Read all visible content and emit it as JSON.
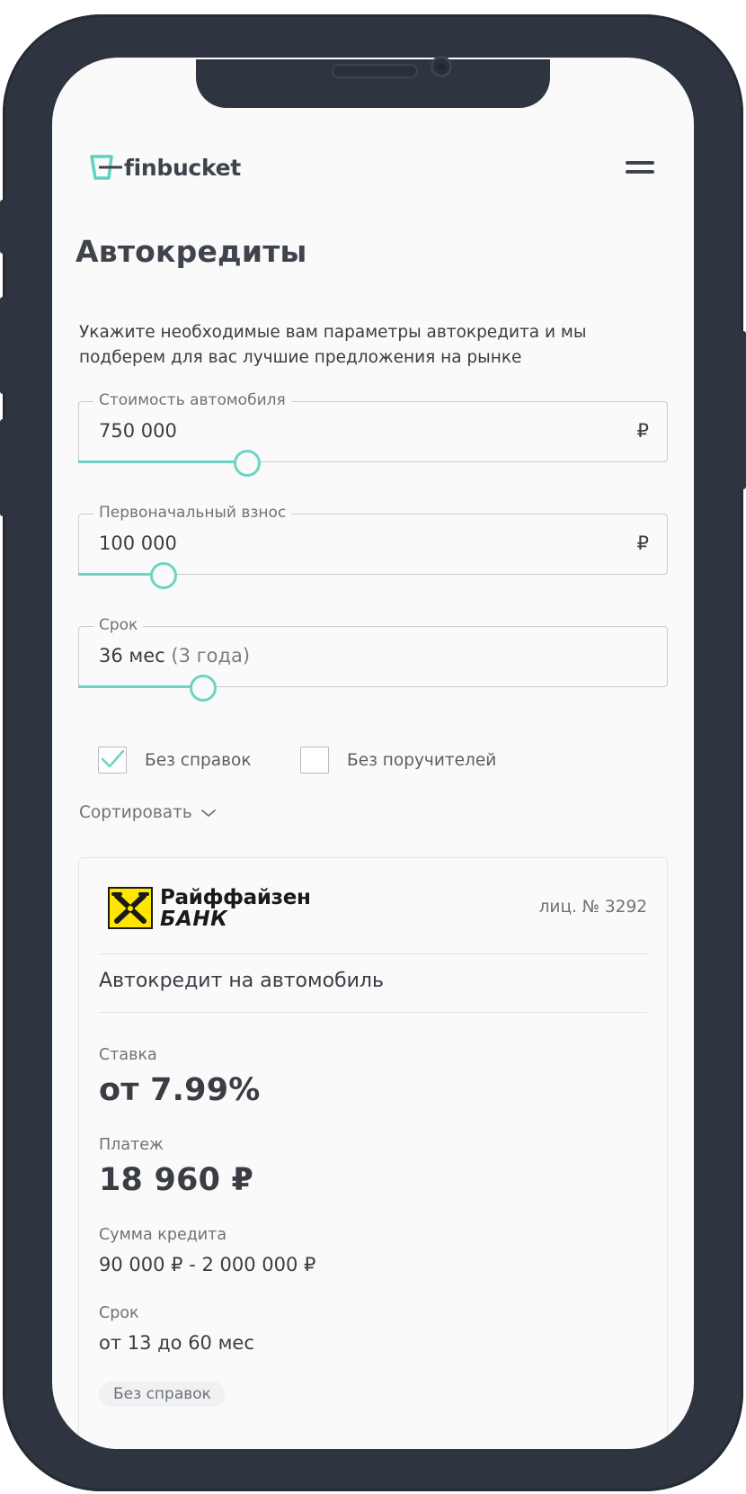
{
  "header": {
    "logo_text": "finbucket",
    "menu_icon": "hamburger-menu-icon"
  },
  "page": {
    "title": "Автокредиты",
    "intro_line1": "Укажите необходимые вам параметры автокредита и мы",
    "intro_line2": "подберем для вас лучшие предложения на рынке"
  },
  "form": {
    "price": {
      "label": "Стоимость автомобиля",
      "value": "750 000",
      "currency": "₽",
      "slider_fraction": 0.285
    },
    "down_payment": {
      "label": "Первоначальный взнос",
      "value": "100 000",
      "currency": "₽",
      "slider_fraction": 0.143
    },
    "term": {
      "label": "Срок",
      "value": "36 мес",
      "hint": "(3 года)",
      "slider_fraction": 0.21
    },
    "no_certificates": {
      "label": "Без справок",
      "checked": true
    },
    "no_guarantors": {
      "label": "Без поручителей",
      "checked": false
    },
    "sort_label": "Сортировать"
  },
  "offer": {
    "bank_name_line1": "Райффайзен",
    "bank_name_line2": "БАНК",
    "license": "лиц. № 3292",
    "product": "Автокредит на автомобиль",
    "rate_label": "Ставка",
    "rate_value": "от 7.99%",
    "payment_label": "Платеж",
    "payment_value": "18 960 ₽",
    "amount_label": "Сумма кредита",
    "amount_value": "90 000 ₽ - 2 000 000 ₽",
    "term_label": "Срок",
    "term_value": "от 13 до 60 мес",
    "tag": "Без справок"
  },
  "colors": {
    "accent": "#6fd3c4",
    "frame": "#2f3540",
    "text": "#3a3d44",
    "muted": "#6f7278",
    "bank_yellow": "#fee600"
  }
}
